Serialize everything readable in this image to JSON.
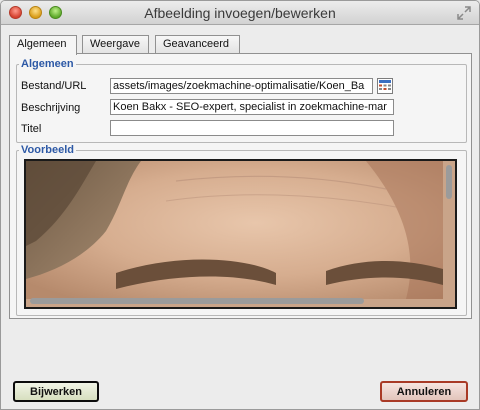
{
  "window": {
    "title": "Afbeelding invoegen/bewerken"
  },
  "tabs": [
    {
      "label": "Algemeen"
    },
    {
      "label": "Weergave"
    },
    {
      "label": "Geavanceerd"
    }
  ],
  "general": {
    "legend": "Algemeen",
    "file_label": "Bestand/URL",
    "file_value": "assets/images/zoekmachine-optimalisatie/Koen_Ba",
    "description_label": "Beschrijving",
    "description_value": "Koen Bakx - SEO-expert, specialist in zoekmachine-mar",
    "title_label": "Titel",
    "title_value": ""
  },
  "preview": {
    "legend": "Voorbeeld"
  },
  "buttons": {
    "update": "Bijwerken",
    "cancel": "Annuleren"
  },
  "colors": {
    "legend": "#2d59a6",
    "update_border": "#0c0c0c",
    "cancel_border": "#a93a26"
  }
}
